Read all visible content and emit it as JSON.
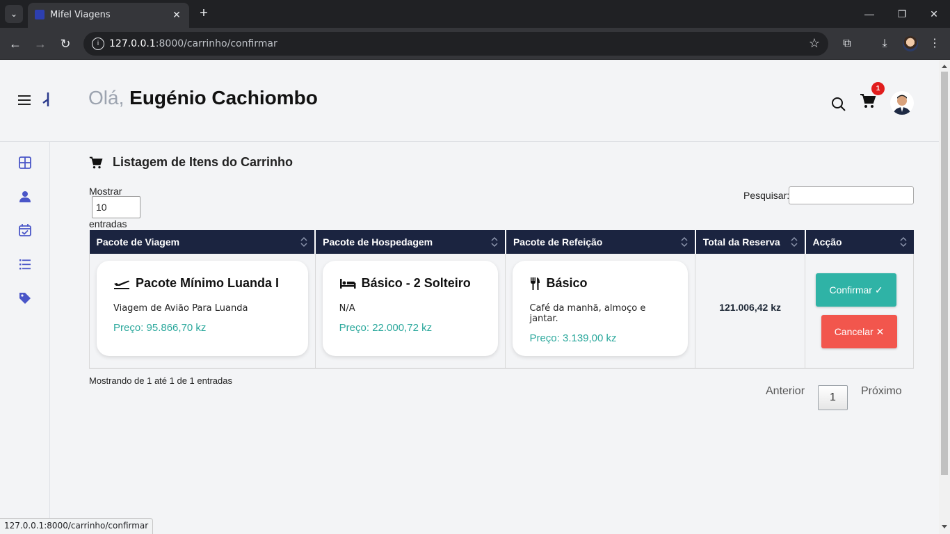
{
  "browser": {
    "tab_title": "Mifel Viagens",
    "url_host": "127.0.0.1",
    "url_rest": ":8000/carrinho/confirmar",
    "status_url": "127.0.0.1:8000/carrinho/confirmar",
    "new_tab_symbol": "+",
    "close_symbol": "✕"
  },
  "header": {
    "greeting": "Olá,",
    "user_name": "Eugénio Cachiombo",
    "cart_count": "1"
  },
  "page": {
    "title": "Listagem de Itens do Carrinho",
    "length_label_before": "Mostrar",
    "length_value": "10",
    "length_label_after": "entradas",
    "search_label": "Pesquisar:",
    "search_value": ""
  },
  "table": {
    "columns": [
      "Pacote de Viagem",
      "Pacote de Hospedagem",
      "Pacote de Refeição",
      "Total da Reserva",
      "Acção"
    ],
    "rows": [
      {
        "trip": {
          "title": "Pacote Mínimo Luanda I",
          "desc": "Viagem de Avião Para Luanda",
          "price": "Preço: 95.866,70 kz",
          "icon": "plane-departure-icon"
        },
        "lodging": {
          "title": "Básico - 2 Solteiro",
          "desc": "N/A",
          "price": "Preço: 22.000,72 kz",
          "icon": "bed-icon"
        },
        "meal": {
          "title": "Básico",
          "desc": "Café da manhã, almoço e jantar.",
          "price": "Preço: 3.139,00 kz",
          "icon": "utensils-icon"
        },
        "total": "121.006,42 kz",
        "confirm_label": "Confirmar ✓",
        "cancel_label": "Cancelar ✕"
      }
    ]
  },
  "footer": {
    "info": "Mostrando de 1 até 1 de 1 entradas",
    "prev": "Anterior",
    "page": "1",
    "next": "Próximo"
  },
  "colors": {
    "table_header": "#1b2440",
    "confirm": "#2fb3a6",
    "cancel": "#f2564d",
    "price": "#2ba89c",
    "sidebar_icon": "#4a56c8"
  }
}
